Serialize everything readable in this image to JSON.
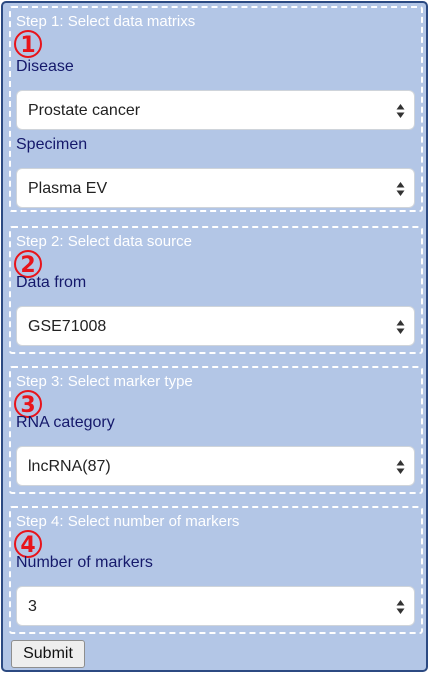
{
  "steps": [
    {
      "title": "Step 1: Select data matrixs",
      "number": "1",
      "fields": [
        {
          "label": "Disease",
          "value": "Prostate cancer"
        },
        {
          "label": "Specimen",
          "value": "Plasma EV"
        }
      ]
    },
    {
      "title": "Step 2: Select data source",
      "number": "2",
      "fields": [
        {
          "label": "Data from",
          "value": "GSE71008"
        }
      ]
    },
    {
      "title": "Step 3: Select marker type",
      "number": "3",
      "fields": [
        {
          "label": "RNA category",
          "value": "lncRNA(87)"
        }
      ]
    },
    {
      "title": "Step 4: Select number of markers",
      "number": "4",
      "fields": [
        {
          "label": "Number of markers",
          "value": "3"
        }
      ]
    }
  ],
  "submit_label": "Submit",
  "icons": {
    "select_arrows": "up-down-arrows-icon"
  },
  "colors": {
    "panel_bg": "#b3c6e6",
    "panel_border": "#2c4a82",
    "label": "#15196b",
    "step_number": "#e8141b"
  }
}
